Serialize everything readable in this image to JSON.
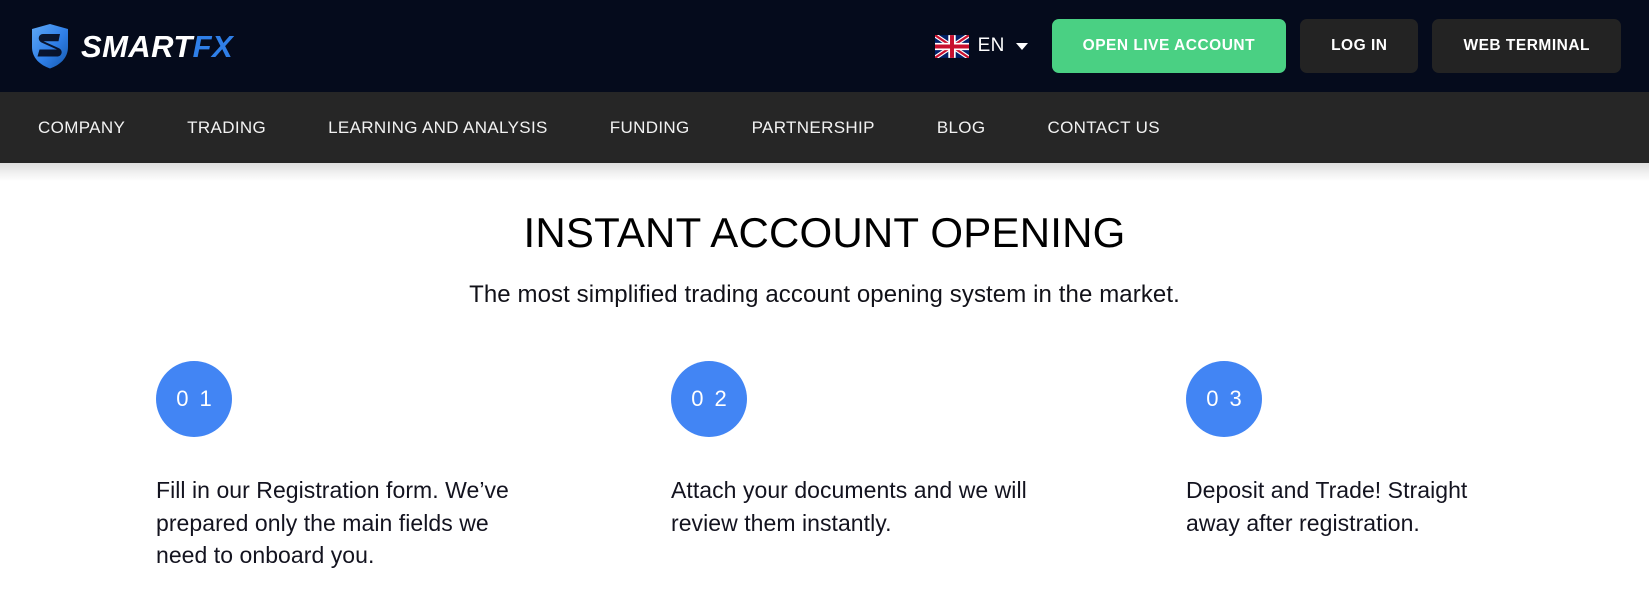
{
  "brand": {
    "name_part1": "SMART",
    "name_part2": "FX",
    "icon": "shield-logo-icon",
    "shield_color": "#2f7fe8"
  },
  "header": {
    "language": {
      "flag_icon": "uk-flag-icon",
      "code": "EN",
      "caret_icon": "chevron-down-icon"
    },
    "buttons": [
      {
        "label": "OPEN LIVE ACCOUNT",
        "style": "primary",
        "color": "#4ad083",
        "name": "open-live-account-button"
      },
      {
        "label": "LOG IN",
        "style": "dark",
        "color": "#232323",
        "name": "log-in-button"
      },
      {
        "label": "WEB TERMINAL",
        "style": "dark",
        "color": "#232323",
        "name": "web-terminal-button"
      }
    ],
    "background_color": "#050b1c"
  },
  "nav": {
    "background_color": "#262626",
    "items": [
      {
        "label": "COMPANY",
        "name": "nav-item-company"
      },
      {
        "label": "TRADING",
        "name": "nav-item-trading"
      },
      {
        "label": "LEARNING AND ANALYSIS",
        "name": "nav-item-learning-and-analysis"
      },
      {
        "label": "FUNDING",
        "name": "nav-item-funding"
      },
      {
        "label": "PARTNERSHIP",
        "name": "nav-item-partnership"
      },
      {
        "label": "BLOG",
        "name": "nav-item-blog"
      },
      {
        "label": "CONTACT US",
        "name": "nav-item-contact-us"
      }
    ]
  },
  "main": {
    "title": "INSTANT ACCOUNT OPENING",
    "subtitle": "The most simplified trading account opening system in the market.",
    "accent_color": "#4285f4",
    "steps": [
      {
        "number": "0 1",
        "text": "Fill in our Registration form. We’ve prepared only the main fields we need to onboard you."
      },
      {
        "number": "0 2",
        "text": "Attach your documents and we will review them instantly."
      },
      {
        "number": "0 3",
        "text": "Deposit and Trade! Straight away after registration."
      }
    ]
  }
}
